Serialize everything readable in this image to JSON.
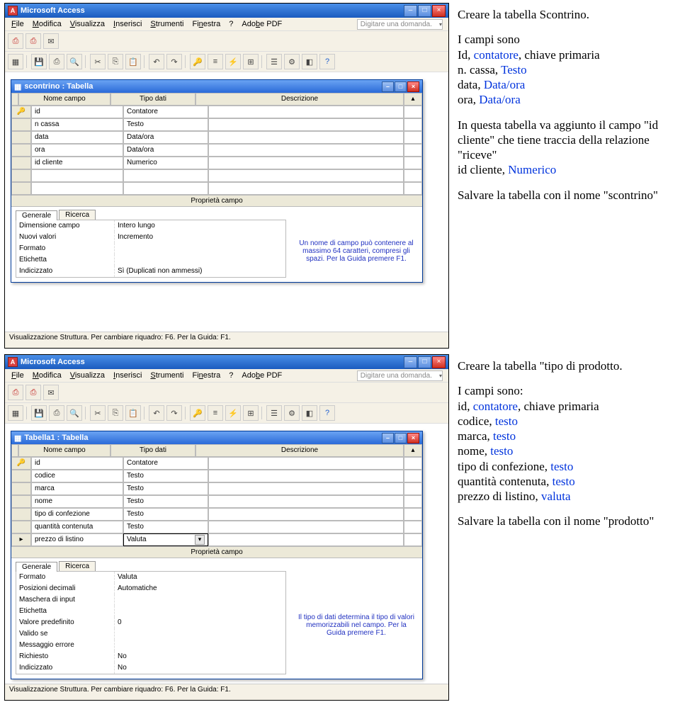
{
  "text1": {
    "title": "Creare la tabella Scontrino.",
    "p1a": "I campi sono",
    "p1b": "Id, ",
    "p1c": "contatore",
    "p1d": ", chiave primaria",
    "p1e": "n. cassa, ",
    "p1f": "Testo",
    "p1g": "data, ",
    "p1h": "Data/ora",
    "p1i": "ora, ",
    "p1j": "Data/ora",
    "p2": "In questa tabella va aggiunto il campo \"id cliente\" che tiene traccia della relazione \"riceve\"",
    "p2b": "id cliente, ",
    "p2c": "Numerico",
    "p3": "Salvare la tabella con il nome \"scontrino\""
  },
  "text2": {
    "title": "Creare la tabella \"tipo di prodotto.",
    "p1": "I campi sono:",
    "l1a": "id, ",
    "l1b": "contatore",
    "l1c": ", chiave primaria",
    "l2a": "codice, ",
    "l2b": "testo",
    "l3a": "marca, ",
    "l3b": "testo",
    "l4a": "nome, ",
    "l4b": "testo",
    "l5a": "tipo di confezione, ",
    "l5b": "testo",
    "l6a": "quantità contenuta, ",
    "l6b": "testo",
    "l7a": "prezzo di listino, ",
    "l7b": "valuta",
    "p2": "Salvare la tabella con il nome \"prodotto\""
  },
  "access": {
    "app_title": "Microsoft Access",
    "menu": [
      "File",
      "Modifica",
      "Visualizza",
      "Inserisci",
      "Strumenti",
      "Finestra",
      "?",
      "Adobe PDF"
    ],
    "menu_un": [
      "F",
      "M",
      "V",
      "I",
      "S",
      "n",
      "",
      "B"
    ],
    "ask": "Digitare una domanda.",
    "statusbar": "Visualizzazione Struttura. Per cambiare riquadro: F6. Per la Guida: F1."
  },
  "win1": {
    "title": "scontrino : Tabella",
    "headers": [
      "Nome campo",
      "Tipo dati",
      "Descrizione"
    ],
    "rows": [
      {
        "key": true,
        "name": "id",
        "type": "Contatore"
      },
      {
        "name": "n cassa",
        "type": "Testo"
      },
      {
        "name": "data",
        "type": "Data/ora"
      },
      {
        "name": "ora",
        "type": "Data/ora"
      },
      {
        "name": "id cliente",
        "type": "Numerico"
      },
      {
        "name": "",
        "type": ""
      },
      {
        "name": "",
        "type": ""
      }
    ],
    "props_title": "Proprietà campo",
    "tabs": [
      "Generale",
      "Ricerca"
    ],
    "props": [
      [
        "Dimensione campo",
        "Intero lungo"
      ],
      [
        "Nuovi valori",
        "Incremento"
      ],
      [
        "Formato",
        ""
      ],
      [
        "Etichetta",
        ""
      ],
      [
        "Indicizzato",
        "Sì (Duplicati non ammessi)"
      ]
    ],
    "hint": "Un nome di campo può contenere al massimo 64 caratteri, compresi gli spazi. Per la Guida premere F1."
  },
  "win2": {
    "title": "Tabella1 : Tabella",
    "headers": [
      "Nome campo",
      "Tipo dati",
      "Descrizione"
    ],
    "rows": [
      {
        "key": true,
        "name": "id",
        "type": "Contatore"
      },
      {
        "name": "codice",
        "type": "Testo"
      },
      {
        "name": "marca",
        "type": "Testo"
      },
      {
        "name": "nome",
        "type": "Testo"
      },
      {
        "name": "tipo di confezione",
        "type": "Testo"
      },
      {
        "name": "quantità contenuta",
        "type": "Testo"
      },
      {
        "name": "prezzo di listino",
        "type": "Valuta",
        "current": true
      }
    ],
    "props_title": "Proprietà campo",
    "tabs": [
      "Generale",
      "Ricerca"
    ],
    "props": [
      [
        "Formato",
        "Valuta"
      ],
      [
        "Posizioni decimali",
        "Automatiche"
      ],
      [
        "Maschera di input",
        ""
      ],
      [
        "Etichetta",
        ""
      ],
      [
        "Valore predefinito",
        "0"
      ],
      [
        "Valido se",
        ""
      ],
      [
        "Messaggio errore",
        ""
      ],
      [
        "Richiesto",
        "No"
      ],
      [
        "Indicizzato",
        "No"
      ]
    ],
    "hint": "Il tipo di dati determina il tipo di valori memorizzabili nel campo. Per la Guida premere F1."
  }
}
